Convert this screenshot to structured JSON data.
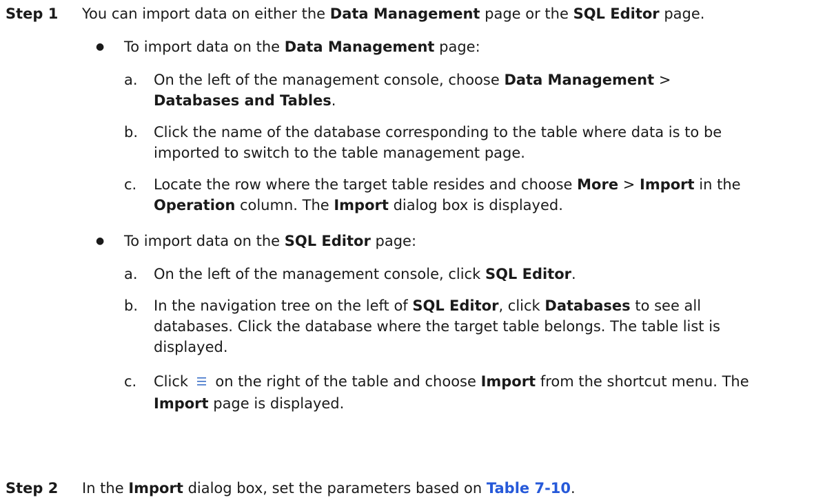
{
  "step1": {
    "label": "Step 1",
    "intro": {
      "t1": "You can import data on either the ",
      "b1": "Data Management",
      "t2": " page or the ",
      "b2": "SQL Editor",
      "t3": " page."
    },
    "dm": {
      "t1": "To import data on the ",
      "b1": "Data Management",
      "t2": " page:",
      "items": [
        {
          "letter": "a.",
          "t1": "On the left of the management console, choose ",
          "b1": "Data Management",
          "t2": " > ",
          "b2": "Databases and Tables",
          "t3": "."
        },
        {
          "letter": "b.",
          "t1": "Click the name of the database corresponding to the table where data is to be imported to switch to the table management page."
        },
        {
          "letter": "c.",
          "t1": "Locate the row where the target table resides and choose ",
          "b1": "More",
          "t2": " > ",
          "b2": "Import",
          "t3": " in the ",
          "b3": "Operation",
          "t4": " column. The ",
          "b4": "Import",
          "t5": " dialog box is displayed."
        }
      ]
    },
    "sql": {
      "t1": "To import data on the ",
      "b1": "SQL Editor",
      "t2": " page:",
      "items": [
        {
          "letter": "a.",
          "t1": "On the left of the management console, click ",
          "b1": "SQL Editor",
          "t2": "."
        },
        {
          "letter": "b.",
          "t1": "In the navigation tree on the left of ",
          "b1": "SQL Editor",
          "t2": ", click ",
          "b2": "Databases",
          "t3": " to see all databases. Click the database where the target table belongs. The table list is displayed."
        },
        {
          "letter": "c.",
          "t1": "Click ",
          "icon": "menu-icon",
          "t2": " on the right of the table and choose ",
          "b1": "Import",
          "t3": " from the shortcut menu. The ",
          "b2": "Import",
          "t4": " page is displayed."
        }
      ]
    }
  },
  "step2": {
    "label": "Step 2",
    "t1": "In the ",
    "b1": "Import",
    "t2": " dialog box, set the parameters based on ",
    "link": "Table 7-10",
    "t3": "."
  },
  "colors": {
    "text": "#1a1a1a",
    "link": "#2659d9"
  }
}
